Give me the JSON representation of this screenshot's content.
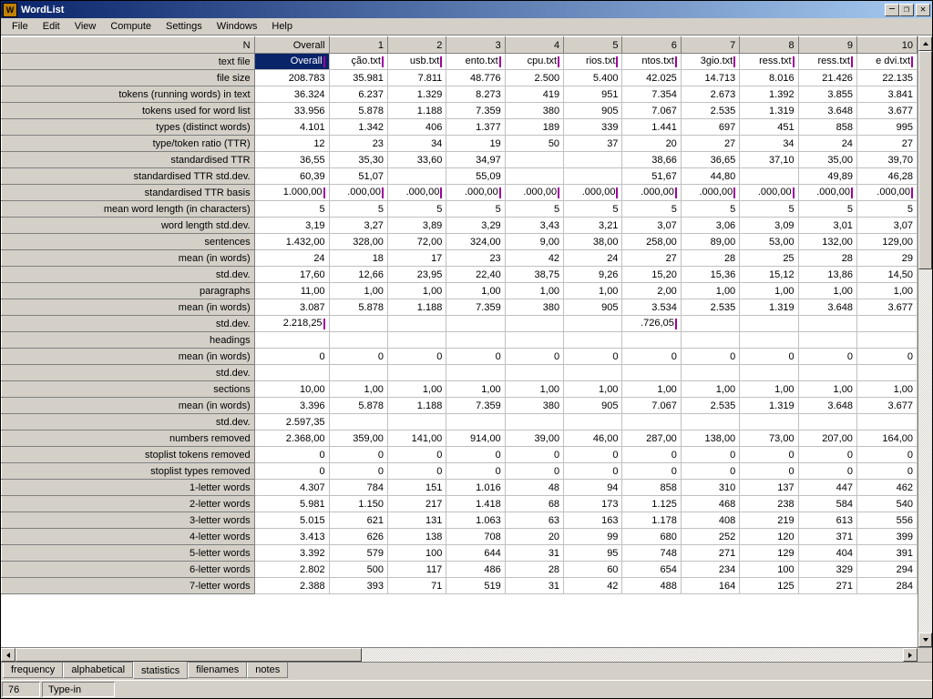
{
  "window": {
    "title": "WordList"
  },
  "menu": [
    "File",
    "Edit",
    "View",
    "Compute",
    "Settings",
    "Windows",
    "Help"
  ],
  "columns": [
    "N",
    "Overall",
    "1",
    "2",
    "3",
    "4",
    "5",
    "6",
    "7",
    "8",
    "9",
    "10"
  ],
  "row_labels": [
    "text file",
    "file size",
    "tokens (running words) in text",
    "tokens used for word list",
    "types (distinct words)",
    "type/token ratio (TTR)",
    "standardised TTR",
    "standardised TTR std.dev.",
    "standardised TTR basis",
    "mean word length (in characters)",
    "word length std.dev.",
    "sentences",
    "mean (in words)",
    "std.dev.",
    "paragraphs",
    "mean (in words)",
    "std.dev.",
    "headings",
    "mean (in words)",
    "std.dev.",
    "sections",
    "mean (in words)",
    "std.dev.",
    "numbers removed",
    "stoplist tokens removed",
    "stoplist types removed",
    "1-letter words",
    "2-letter words",
    "3-letter words",
    "4-letter words",
    "5-letter words",
    "6-letter words",
    "7-letter words"
  ],
  "rows": [
    [
      "Overall",
      "ção.txt",
      "usb.txt",
      "ento.txt",
      "cpu.txt",
      "rios.txt",
      "ntos.txt",
      "3gio.txt",
      "ress.txt",
      "ress.txt",
      "e dvi.txt"
    ],
    [
      "208.783",
      "35.981",
      "7.811",
      "48.776",
      "2.500",
      "5.400",
      "42.025",
      "14.713",
      "8.016",
      "21.426",
      "22.135"
    ],
    [
      "36.324",
      "6.237",
      "1.329",
      "8.273",
      "419",
      "951",
      "7.354",
      "2.673",
      "1.392",
      "3.855",
      "3.841"
    ],
    [
      "33.956",
      "5.878",
      "1.188",
      "7.359",
      "380",
      "905",
      "7.067",
      "2.535",
      "1.319",
      "3.648",
      "3.677"
    ],
    [
      "4.101",
      "1.342",
      "406",
      "1.377",
      "189",
      "339",
      "1.441",
      "697",
      "451",
      "858",
      "995"
    ],
    [
      "12",
      "23",
      "34",
      "19",
      "50",
      "37",
      "20",
      "27",
      "34",
      "24",
      "27"
    ],
    [
      "36,55",
      "35,30",
      "33,60",
      "34,97",
      "",
      "",
      "38,66",
      "36,65",
      "37,10",
      "35,00",
      "39,70"
    ],
    [
      "60,39",
      "51,07",
      "",
      "55,09",
      "",
      "",
      "51,67",
      "44,80",
      "",
      "49,89",
      "46,28"
    ],
    [
      "1.000,00",
      ".000,00",
      ".000,00",
      ".000,00",
      ".000,00",
      ".000,00",
      ".000,00",
      ".000,00",
      ".000,00",
      ".000,00",
      ".000,00"
    ],
    [
      "5",
      "5",
      "5",
      "5",
      "5",
      "5",
      "5",
      "5",
      "5",
      "5",
      "5"
    ],
    [
      "3,19",
      "3,27",
      "3,89",
      "3,29",
      "3,43",
      "3,21",
      "3,07",
      "3,06",
      "3,09",
      "3,01",
      "3,07"
    ],
    [
      "1.432,00",
      "328,00",
      "72,00",
      "324,00",
      "9,00",
      "38,00",
      "258,00",
      "89,00",
      "53,00",
      "132,00",
      "129,00"
    ],
    [
      "24",
      "18",
      "17",
      "23",
      "42",
      "24",
      "27",
      "28",
      "25",
      "28",
      "29"
    ],
    [
      "17,60",
      "12,66",
      "23,95",
      "22,40",
      "38,75",
      "9,26",
      "15,20",
      "15,36",
      "15,12",
      "13,86",
      "14,50"
    ],
    [
      "11,00",
      "1,00",
      "1,00",
      "1,00",
      "1,00",
      "1,00",
      "2,00",
      "1,00",
      "1,00",
      "1,00",
      "1,00"
    ],
    [
      "3.087",
      "5.878",
      "1.188",
      "7.359",
      "380",
      "905",
      "3.534",
      "2.535",
      "1.319",
      "3.648",
      "3.677"
    ],
    [
      "2.218,25",
      "",
      "",
      "",
      "",
      "",
      ".726,05",
      "",
      "",
      "",
      ""
    ],
    [
      "",
      "",
      "",
      "",
      "",
      "",
      "",
      "",
      "",
      "",
      ""
    ],
    [
      "0",
      "0",
      "0",
      "0",
      "0",
      "0",
      "0",
      "0",
      "0",
      "0",
      "0"
    ],
    [
      "",
      "",
      "",
      "",
      "",
      "",
      "",
      "",
      "",
      "",
      ""
    ],
    [
      "10,00",
      "1,00",
      "1,00",
      "1,00",
      "1,00",
      "1,00",
      "1,00",
      "1,00",
      "1,00",
      "1,00",
      "1,00"
    ],
    [
      "3.396",
      "5.878",
      "1.188",
      "7.359",
      "380",
      "905",
      "7.067",
      "2.535",
      "1.319",
      "3.648",
      "3.677"
    ],
    [
      "2.597,35",
      "",
      "",
      "",
      "",
      "",
      "",
      "",
      "",
      "",
      ""
    ],
    [
      "2.368,00",
      "359,00",
      "141,00",
      "914,00",
      "39,00",
      "46,00",
      "287,00",
      "138,00",
      "73,00",
      "207,00",
      "164,00"
    ],
    [
      "0",
      "0",
      "0",
      "0",
      "0",
      "0",
      "0",
      "0",
      "0",
      "0",
      "0"
    ],
    [
      "0",
      "0",
      "0",
      "0",
      "0",
      "0",
      "0",
      "0",
      "0",
      "0",
      "0"
    ],
    [
      "4.307",
      "784",
      "151",
      "1.016",
      "48",
      "94",
      "858",
      "310",
      "137",
      "447",
      "462"
    ],
    [
      "5.981",
      "1.150",
      "217",
      "1.418",
      "68",
      "173",
      "1.125",
      "468",
      "238",
      "584",
      "540"
    ],
    [
      "5.015",
      "621",
      "131",
      "1.063",
      "63",
      "163",
      "1.178",
      "408",
      "219",
      "613",
      "556"
    ],
    [
      "3.413",
      "626",
      "138",
      "708",
      "20",
      "99",
      "680",
      "252",
      "120",
      "371",
      "399"
    ],
    [
      "3.392",
      "579",
      "100",
      "644",
      "31",
      "95",
      "748",
      "271",
      "129",
      "404",
      "391"
    ],
    [
      "2.802",
      "500",
      "117",
      "486",
      "28",
      "60",
      "654",
      "234",
      "100",
      "329",
      "294"
    ],
    [
      "2.388",
      "393",
      "71",
      "519",
      "31",
      "42",
      "488",
      "164",
      "125",
      "271",
      "284"
    ]
  ],
  "mark_rows": {
    "0": true,
    "8": true,
    "16": true
  },
  "tabs": [
    "frequency",
    "alphabetical",
    "statistics",
    "filenames",
    "notes"
  ],
  "active_tab": 2,
  "status": {
    "left": "76",
    "mode": "Type-in"
  }
}
